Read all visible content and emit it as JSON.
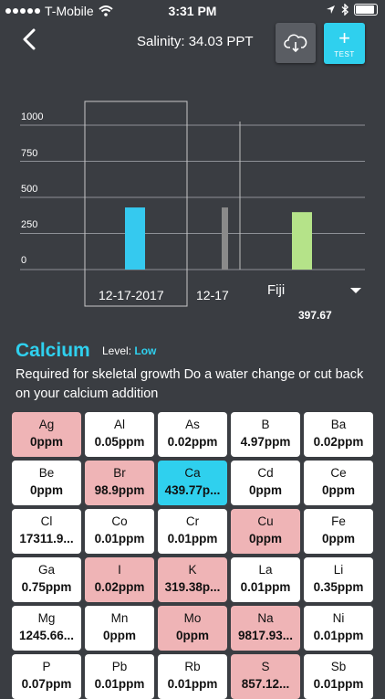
{
  "status": {
    "carrier": "T-Mobile",
    "time": "3:31 PM"
  },
  "header": {
    "salinity": "Salinity: 34.03 PPT",
    "test_label": "TEST",
    "plus": "+"
  },
  "chart_data": {
    "type": "bar",
    "categories": [
      "12-17-2017",
      "12-17",
      "Fiji"
    ],
    "values": [
      430,
      430,
      397.67
    ],
    "colors": [
      "#35c9ef",
      "#8a8a8a",
      "#b5e389"
    ],
    "yticks": [
      "1000",
      "750",
      "500",
      "250",
      "0"
    ],
    "ylim": [
      0,
      1000
    ],
    "selected_label": "Fiji",
    "selected_value": "397.67"
  },
  "detail": {
    "name": "Calcium",
    "level_label": "Level:",
    "level_value": "Low",
    "description": "Required for skeletal growth Do a water change or cut back on your calcium addition"
  },
  "elements": [
    {
      "sym": "Ag",
      "val": "0ppm",
      "state": "warn"
    },
    {
      "sym": "Al",
      "val": "0.05ppm",
      "state": "ok"
    },
    {
      "sym": "As",
      "val": "0.02ppm",
      "state": "ok"
    },
    {
      "sym": "B",
      "val": "4.97ppm",
      "state": "ok"
    },
    {
      "sym": "Ba",
      "val": "0.02ppm",
      "state": "ok"
    },
    {
      "sym": "Be",
      "val": "0ppm",
      "state": "ok"
    },
    {
      "sym": "Br",
      "val": "98.9ppm",
      "state": "warn"
    },
    {
      "sym": "Ca",
      "val": "439.77p...",
      "state": "sel"
    },
    {
      "sym": "Cd",
      "val": "0ppm",
      "state": "ok"
    },
    {
      "sym": "Ce",
      "val": "0ppm",
      "state": "ok"
    },
    {
      "sym": "Cl",
      "val": "17311.9...",
      "state": "ok"
    },
    {
      "sym": "Co",
      "val": "0.01ppm",
      "state": "ok"
    },
    {
      "sym": "Cr",
      "val": "0.01ppm",
      "state": "ok"
    },
    {
      "sym": "Cu",
      "val": "0ppm",
      "state": "warn"
    },
    {
      "sym": "Fe",
      "val": "0ppm",
      "state": "ok"
    },
    {
      "sym": "Ga",
      "val": "0.75ppm",
      "state": "ok"
    },
    {
      "sym": "I",
      "val": "0.02ppm",
      "state": "warn"
    },
    {
      "sym": "K",
      "val": "319.38p...",
      "state": "warn"
    },
    {
      "sym": "La",
      "val": "0.01ppm",
      "state": "ok"
    },
    {
      "sym": "Li",
      "val": "0.35ppm",
      "state": "ok"
    },
    {
      "sym": "Mg",
      "val": "1245.66...",
      "state": "ok"
    },
    {
      "sym": "Mn",
      "val": "0ppm",
      "state": "ok"
    },
    {
      "sym": "Mo",
      "val": "0ppm",
      "state": "warn"
    },
    {
      "sym": "Na",
      "val": "9817.93...",
      "state": "warn"
    },
    {
      "sym": "Ni",
      "val": "0.01ppm",
      "state": "ok"
    },
    {
      "sym": "P",
      "val": "0.07ppm",
      "state": "ok"
    },
    {
      "sym": "Pb",
      "val": "0.01ppm",
      "state": "ok"
    },
    {
      "sym": "Rb",
      "val": "0.01ppm",
      "state": "ok"
    },
    {
      "sym": "S",
      "val": "857.12...",
      "state": "warn"
    },
    {
      "sym": "Sb",
      "val": "0.01ppm",
      "state": "ok"
    }
  ]
}
